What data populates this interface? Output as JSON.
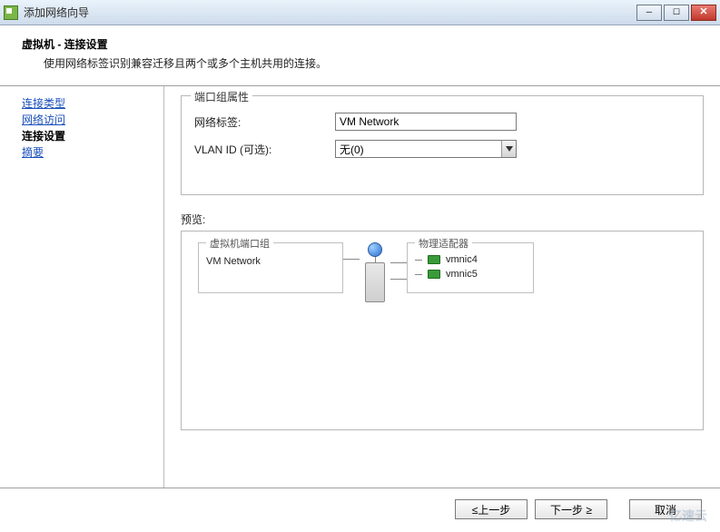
{
  "window": {
    "title": "添加网络向导"
  },
  "header": {
    "title": "虚拟机 - 连接设置",
    "subtitle": "使用网络标签识别兼容迁移且两个或多个主机共用的连接。"
  },
  "sidebar": {
    "steps": [
      {
        "label": "连接类型"
      },
      {
        "label": "网络访问"
      },
      {
        "label": "连接设置"
      },
      {
        "label": "摘要"
      }
    ]
  },
  "props": {
    "group_title": "端口组属性",
    "network_label_label": "网络标签:",
    "network_label_value": "VM Network",
    "vlan_label": "VLAN ID (可选):",
    "vlan_value": "无(0)"
  },
  "preview": {
    "label": "预览:",
    "port_group_legend": "虚拟机端口组",
    "port_group_name": "VM Network",
    "adapter_legend": "物理适配器",
    "adapters": [
      "vmnic4",
      "vmnic5"
    ]
  },
  "footer": {
    "back": "≤上一步",
    "next": "下一步 ≥",
    "cancel": "取消"
  },
  "watermark": "亿速云"
}
